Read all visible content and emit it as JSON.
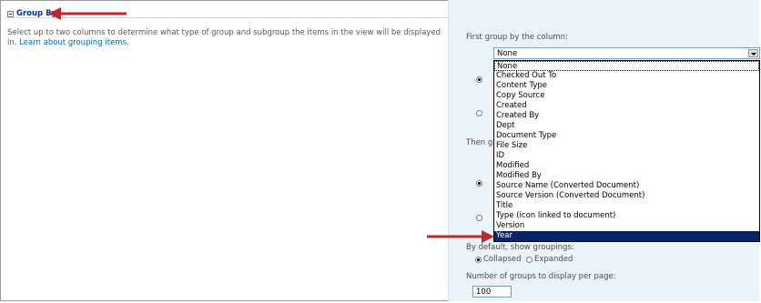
{
  "section": {
    "title": "Group By",
    "description": "Select up to two columns to determine what type of group and subgroup the items in the view will be displayed in.",
    "learn_link": "Learn about grouping items."
  },
  "first_group": {
    "label": "First group by the column:",
    "selected": "None",
    "options": [
      "None",
      "Checked Out To",
      "Content Type",
      "Copy Source",
      "Created",
      "Created By",
      "Dept",
      "Document Type",
      "File Size",
      "ID",
      "Modified",
      "Modified By",
      "Source Name (Converted Document)",
      "Source Version (Converted Document)",
      "Title",
      "Type (icon linked to document)",
      "Version",
      "Year"
    ],
    "highlighted": "Year"
  },
  "then_group": {
    "label_visible": "Then g"
  },
  "default_groupings": {
    "label": "By default, show groupings:",
    "collapsed_label": "Collapsed",
    "expanded_label": "Expanded",
    "selected": "Collapsed"
  },
  "groups_per_page": {
    "label": "Number of groups to display per page:",
    "value": "100"
  },
  "colors": {
    "arrow": "#c0272d",
    "selection": "#0a246a",
    "panel": "#ebf3fb",
    "title": "#003399"
  }
}
